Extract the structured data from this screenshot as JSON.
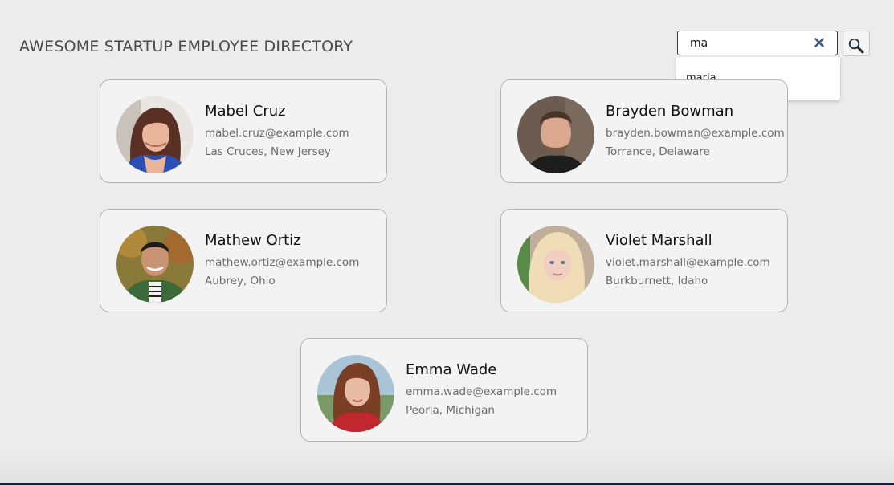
{
  "header": {
    "title": "AWESOME STARTUP EMPLOYEE DIRECTORY"
  },
  "search": {
    "value": "ma",
    "placeholder": "",
    "clear_icon": "close-icon",
    "button_icon": "search-icon",
    "suggestions": [
      "maria"
    ]
  },
  "employees": [
    {
      "name": "Mabel Cruz",
      "email": "mabel.cruz@example.com",
      "location": "Las Cruces, New Jersey"
    },
    {
      "name": "Brayden Bowman",
      "email": "brayden.bowman@example.com",
      "location": "Torrance, Delaware"
    },
    {
      "name": "Mathew Ortiz",
      "email": "mathew.ortiz@example.com",
      "location": "Aubrey, Ohio"
    },
    {
      "name": "Violet Marshall",
      "email": "violet.marshall@example.com",
      "location": "Burkburnett, Idaho"
    },
    {
      "name": "Emma Wade",
      "email": "emma.wade@example.com",
      "location": "Peoria, Michigan"
    }
  ],
  "colors": {
    "page_background": "#ececec",
    "card_background": "#f3f3f3",
    "card_border": "#b4b4b4",
    "clear_icon": "#3b5a8a"
  }
}
